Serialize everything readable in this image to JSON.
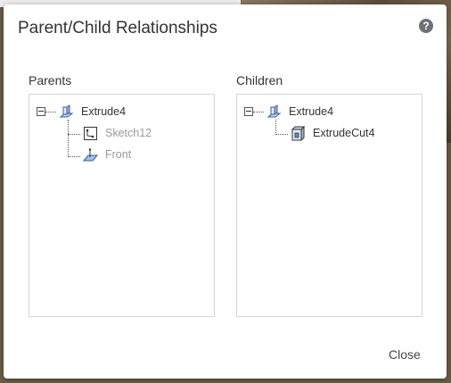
{
  "dialog": {
    "title": "Parent/Child Relationships",
    "help_icon": "help-icon",
    "close_label": "Close"
  },
  "parents": {
    "heading": "Parents",
    "root": {
      "label": "Extrude4",
      "icon": "extrude-icon"
    },
    "children": [
      {
        "label": "Sketch12",
        "icon": "sketch-icon"
      },
      {
        "label": "Front",
        "icon": "plane-icon"
      }
    ]
  },
  "children_panel": {
    "heading": "Children",
    "root": {
      "label": "Extrude4",
      "icon": "extrude-icon"
    },
    "children": [
      {
        "label": "ExtrudeCut4",
        "icon": "extrude-cut-icon"
      }
    ]
  },
  "colors": {
    "accent_blue": "#2f5fa8",
    "muted_text": "#9a9a9a",
    "text": "#333333"
  }
}
